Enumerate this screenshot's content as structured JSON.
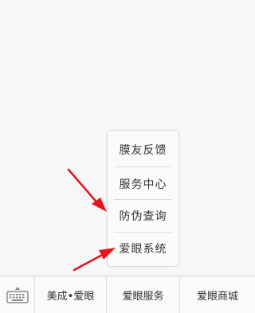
{
  "menu": {
    "items": [
      {
        "label": "膜友反馈"
      },
      {
        "label": "服务中心"
      },
      {
        "label": "防伪查询"
      },
      {
        "label": "爱眼系统"
      }
    ]
  },
  "bottom_bar": {
    "keyboard_icon": "keyboard-icon",
    "tabs": [
      {
        "label": "美成•爱眼"
      },
      {
        "label": "爱眼服务"
      },
      {
        "label": "爱眼商城"
      }
    ]
  },
  "annotations": {
    "arrow_color": "#e8141a"
  }
}
